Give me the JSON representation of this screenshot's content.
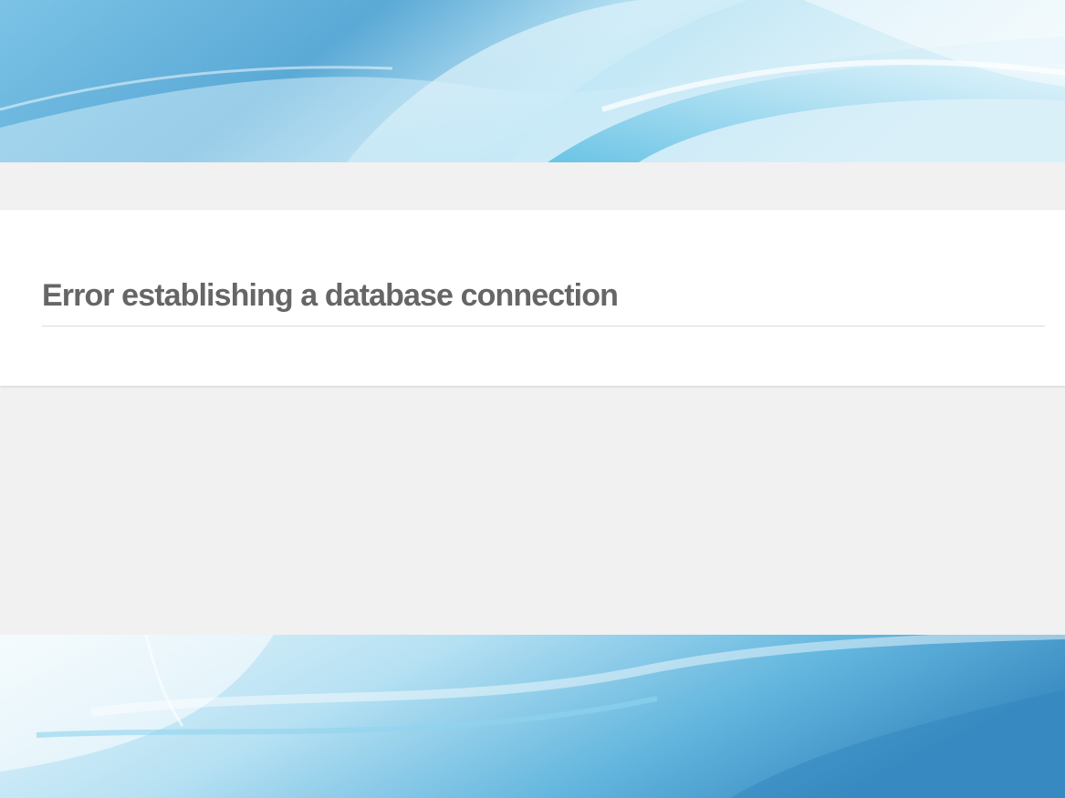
{
  "page": {
    "error_heading": "Error establishing a database connection"
  },
  "theme": {
    "panel_background": "#ffffff",
    "page_background": "#f1f1f1",
    "heading_color": "#666666",
    "divider_color": "#dcdcde",
    "wallpaper_colors": [
      "#3e8fc4",
      "#8fd0ec",
      "#ffffff"
    ]
  }
}
